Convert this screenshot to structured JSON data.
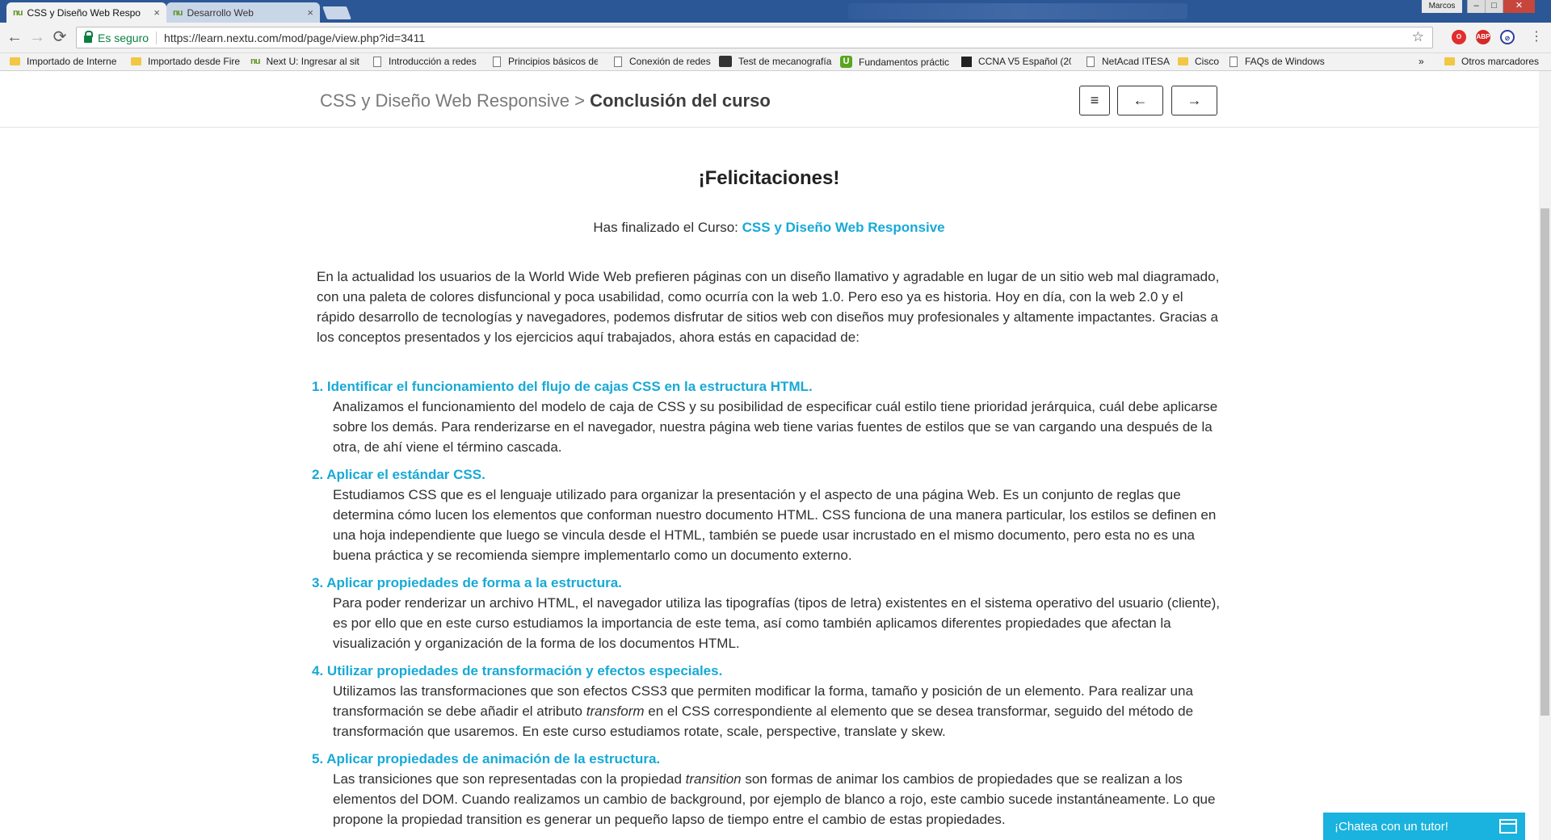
{
  "browser": {
    "tabs": [
      {
        "favicon": "nu",
        "title": "CSS y Diseño Web Respo",
        "close": "×"
      },
      {
        "favicon": "nu",
        "title": "Desarrollo Web",
        "close": "×"
      }
    ],
    "user": "Marcos",
    "window_controls": [
      "–",
      "□",
      "✕"
    ],
    "nav": {
      "back": "←",
      "forward": "→",
      "reload": "⟳"
    },
    "omnibox": {
      "secure_label": "Es seguro",
      "url": "https://learn.nextu.com/mod/page/view.php?id=3411",
      "star": "☆"
    },
    "bookmarks": [
      {
        "icon": "folder",
        "label": "Importado de Interne"
      },
      {
        "icon": "folder",
        "label": "Importado desde Fire"
      },
      {
        "icon": "nu",
        "label": "Next U: Ingresar al sit"
      },
      {
        "icon": "page",
        "label": "Introducción a redes"
      },
      {
        "icon": "page",
        "label": "Principios básicos de"
      },
      {
        "icon": "page",
        "label": "Conexión de redes"
      },
      {
        "icon": "typing",
        "label": "Test de mecanografía"
      },
      {
        "icon": "u",
        "label": "Fundamentos práctic"
      },
      {
        "icon": "dark",
        "label": "CCNA V5 Español (20"
      },
      {
        "icon": "page",
        "label": "NetAcad ITESA"
      },
      {
        "icon": "folder",
        "label": "Cisco"
      },
      {
        "icon": "page",
        "label": "FAQs de Windows"
      }
    ],
    "more_bookmarks": "»",
    "other_bookmarks": "Otros marcadores"
  },
  "header": {
    "course": "CSS y Diseño Web Responsive",
    "separator": ">",
    "current": "Conclusión del curso",
    "menu_label": "≡",
    "prev_label": "←",
    "next_label": "→"
  },
  "content": {
    "heading": "¡Felicitaciones!",
    "finished_prefix": "Has finalizado el Curso:",
    "finished_course": "CSS y Diseño Web Responsive",
    "intro": "En la actualidad los usuarios de la World Wide Web prefieren páginas con un diseño llamativo y agradable en lugar de un sitio web mal diagramado, con una paleta de colores disfuncional y poca usabilidad, como ocurría con la web 1.0. Pero eso ya es historia. Hoy en día, con la web 2.0 y el rápido desarrollo de tecnologías y navegadores, podemos disfrutar de sitios web con diseños muy profesionales y altamente impactantes. Gracias a los conceptos presentados y los ejercicios aquí trabajados, ahora estás en capacidad de:",
    "objectives": [
      {
        "number": "1.",
        "title": "Identificar el funcionamiento del flujo de cajas CSS en la estructura HTML.",
        "desc": "Analizamos el funcionamiento del modelo de caja de CSS y su posibilidad de especificar cuál estilo tiene prioridad jerárquica, cuál debe aplicarse sobre los demás. Para renderizarse en el navegador, nuestra página web tiene varias fuentes de estilos que se van cargando una después de la otra, de ahí viene el término cascada."
      },
      {
        "number": "2.",
        "title": "Aplicar el estándar CSS.",
        "desc": "Estudiamos CSS que es el lenguaje utilizado para organizar la presentación y el aspecto de una página Web. Es un conjunto de reglas que determina cómo lucen los elementos que conforman nuestro documento HTML. CSS funciona de una manera particular, los estilos se definen en una hoja independiente que luego se vincula desde el HTML, también se puede usar incrustado en el mismo documento, pero esta no es una buena práctica y se recomienda siempre implementarlo como un documento externo."
      },
      {
        "number": "3.",
        "title": "Aplicar propiedades de forma a la estructura.",
        "desc": "Para poder renderizar un archivo HTML, el navegador utiliza las tipografías (tipos de letra) existentes en el sistema operativo del usuario (cliente), es por ello que en este curso estudiamos la importancia de este tema, así como también aplicamos diferentes propiedades que afectan la visualización y organización de la forma de los documentos HTML."
      },
      {
        "number": "4.",
        "title": "Utilizar propiedades de transformación y efectos especiales.",
        "desc_a": "Utilizamos las transformaciones que son efectos CSS3 que permiten modificar la forma, tamaño y posición de un elemento. Para realizar una transformación se debe añadir el atributo ",
        "desc_em": "transform",
        "desc_b": " en el CSS correspondiente al elemento que se desea transformar, seguido del método de transformación que usaremos. En este curso estudiamos rotate, scale, perspective, translate y skew."
      },
      {
        "number": "5.",
        "title": "Aplicar propiedades de animación de la estructura.",
        "desc_a": "Las transiciones que son representadas con la propiedad ",
        "desc_em": "transition",
        "desc_b": " son formas de animar los cambios de propiedades que se realizan a los elementos del DOM. Cuando realizamos un cambio de background, por ejemplo de blanco a rojo, este cambio sucede instantáneamente. Lo que propone la propiedad transition es generar un pequeño lapso de tiempo entre el cambio de estas propiedades."
      }
    ]
  },
  "chat": {
    "label": "¡Chatea con un tutor!"
  },
  "colors": {
    "accent": "#17a9d6",
    "chat": "#1ab2de",
    "secure": "#0b8043"
  }
}
